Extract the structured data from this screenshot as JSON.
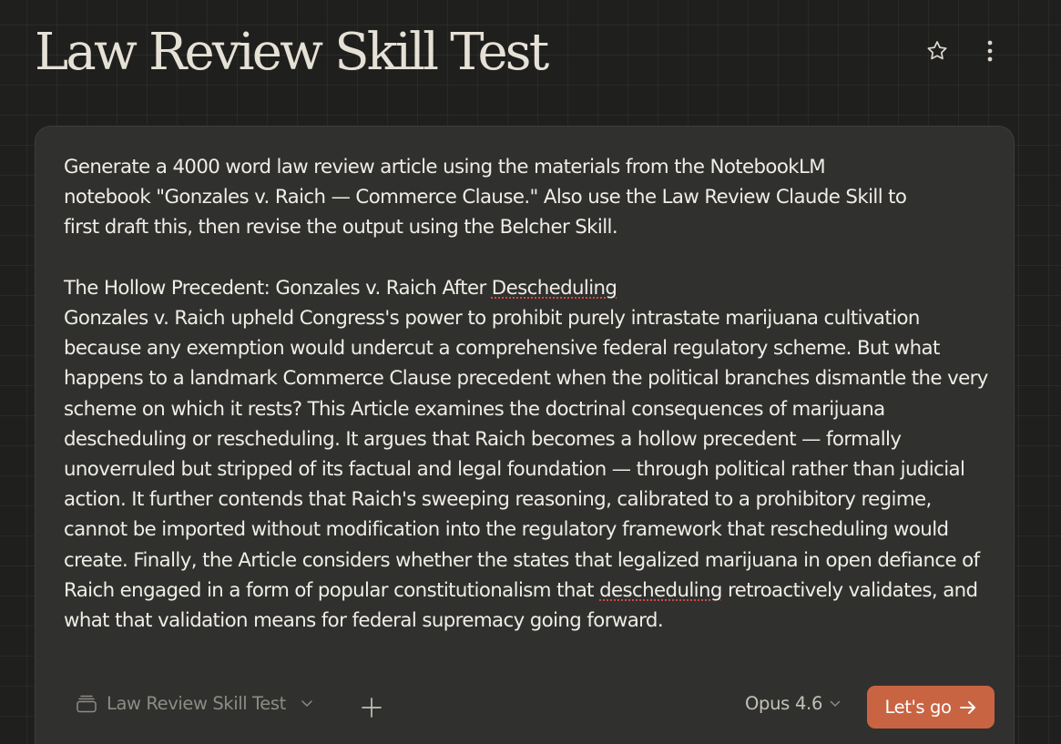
{
  "page": {
    "title": "Law Review Skill Test"
  },
  "header": {
    "star_icon": "star-outline-icon",
    "more_icon": "vertical-ellipsis-icon"
  },
  "composer": {
    "prompt_line1": "Generate a 4000 word law review article using the materials from the NotebookLM",
    "prompt_line2": "notebook \"Gonzales v. Raich — Commerce Clause.\" Also use the Law Review Claude Skill to",
    "prompt_line3": "first draft this, then revise the output using the Belcher Skill.",
    "article_title_prefix": "The Hollow Precedent: Gonzales v. Raich After ",
    "article_title_flagged": "Descheduling",
    "abstract_part1": "Gonzales v. Raich upheld Congress's power to prohibit purely intrastate marijuana cultivation because any exemption would undercut a comprehensive federal regulatory scheme. But what happens to a landmark Commerce Clause precedent when the political branches dismantle the very scheme on which it rests? This Article examines the doctrinal consequences of marijuana descheduling or rescheduling. It argues that Raich becomes a hollow precedent — formally unoverruled but stripped of its factual and legal foundation — through political rather than judicial action. It further contends that Raich's sweeping reasoning, calibrated to a prohibitory regime, cannot be imported without modification into the regulatory framework that rescheduling would create. Finally, the Article considers whether the states that legalized marijuana in open defiance of Raich engaged in a form of popular constitutionalism that ",
    "abstract_flagged": "descheduling",
    "abstract_part2": " retroactively validates, and what that validation means for federal supremacy going forward."
  },
  "toolbar": {
    "project_icon": "project-box-icon",
    "project_label": "Law Review Skill Test",
    "project_chevron": "chevron-down-icon",
    "add_icon": "plus-icon",
    "model_label": "Opus 4.6",
    "model_chevron": "chevron-down-icon",
    "submit_label": "Let's go",
    "submit_icon": "arrow-right-icon"
  },
  "colors": {
    "background": "#1f1f1e",
    "composer_bg": "#30302e",
    "accent": "#c96442",
    "spellcheck": "#d04b43"
  }
}
